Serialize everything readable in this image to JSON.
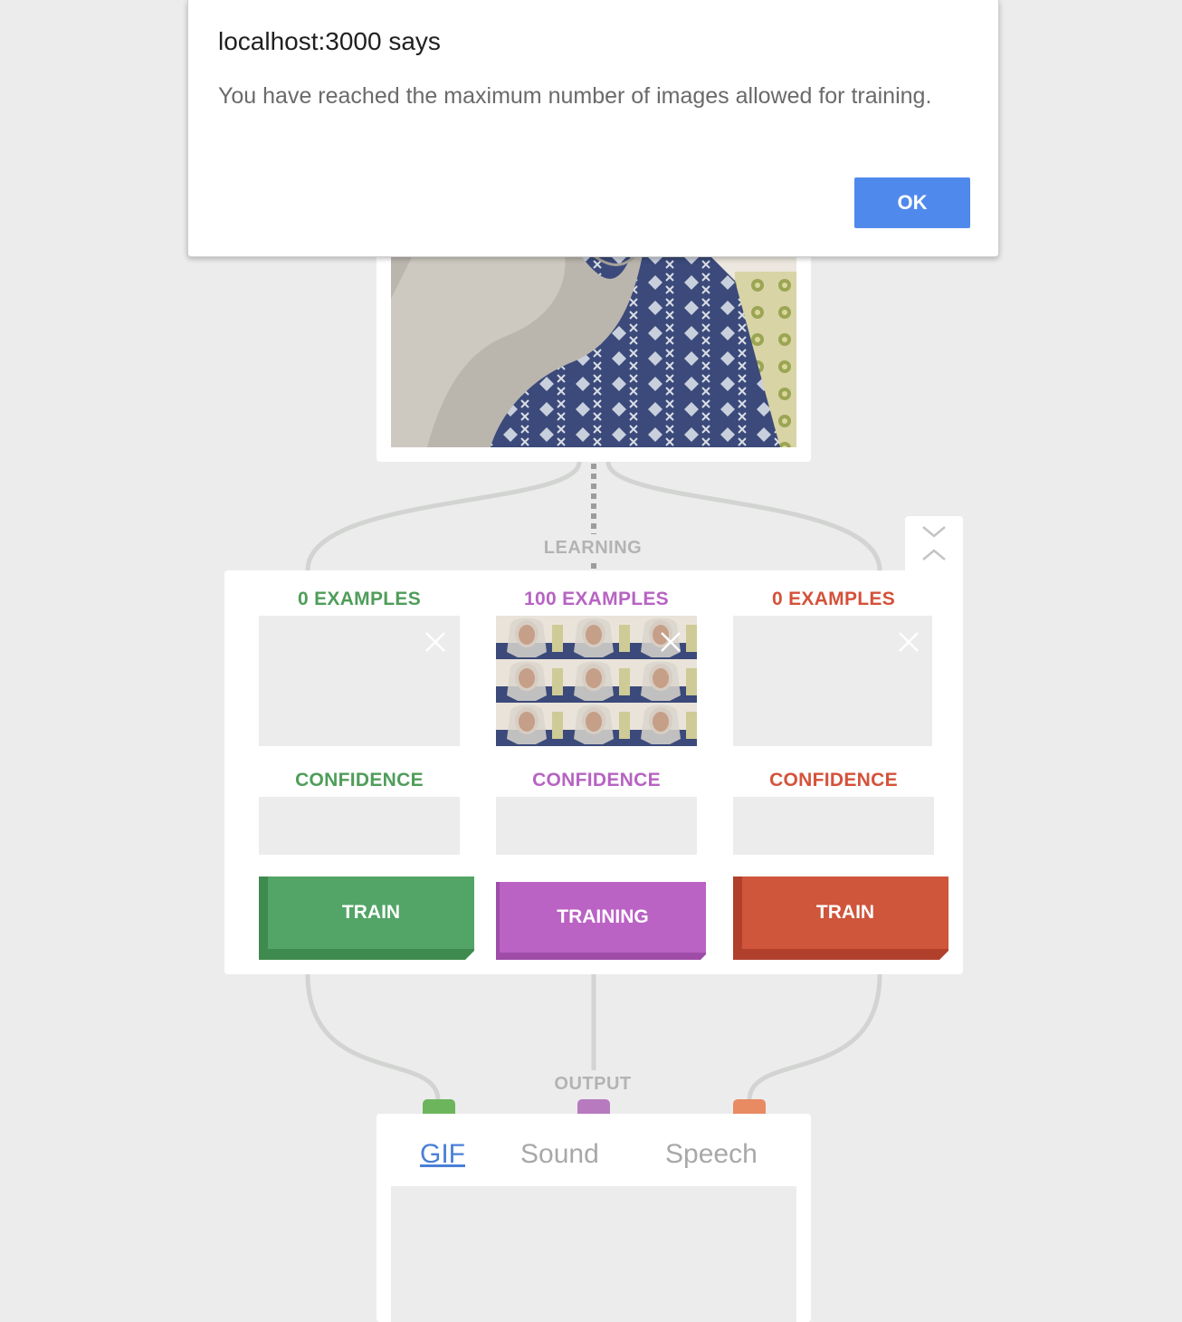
{
  "dialog": {
    "title": "localhost:3000 says",
    "message": "You have reached the maximum number of images allowed for training.",
    "ok_label": "OK"
  },
  "stages": {
    "learning": "LEARNING",
    "output": "OUTPUT"
  },
  "classes": [
    {
      "examples_label": "0 EXAMPLES",
      "confidence_label": "CONFIDENCE",
      "button_label": "TRAIN",
      "color": "#4f9d5a",
      "button_color": "#52a566"
    },
    {
      "examples_label": "100 EXAMPLES",
      "confidence_label": "CONFIDENCE",
      "button_label": "TRAINING",
      "color": "#b763c3",
      "button_color": "#bb62c5"
    },
    {
      "examples_label": "0 EXAMPLES",
      "confidence_label": "CONFIDENCE",
      "button_label": "TRAIN",
      "color": "#d4523a",
      "button_color": "#cf553b"
    }
  ],
  "output": {
    "tabs": [
      "GIF",
      "Sound",
      "Speech"
    ],
    "active_tab": "GIF"
  },
  "icons": {
    "collapse": "collapse-chevrons-icon",
    "clear": "close-icon"
  }
}
